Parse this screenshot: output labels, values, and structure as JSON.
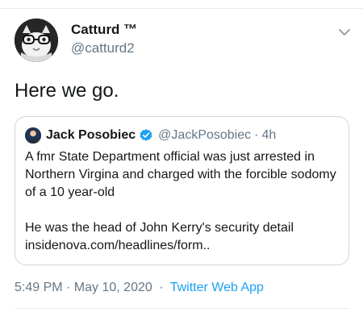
{
  "tweet": {
    "author": {
      "display_name": "Catturd ™",
      "handle": "@catturd2",
      "avatar_icon": "cat-with-glasses-avatar"
    },
    "text": "Here we go.",
    "menu_icon": "chevron-down-icon",
    "quoted_tweet": {
      "author": {
        "display_name": "Jack Posobiec",
        "handle": "@JackPosobiec",
        "verified": true,
        "avatar_icon": "person-avatar"
      },
      "separator": "·",
      "time": "4h",
      "paragraphs": [
        "A fmr State Department official was just arrested in Northern Virgina and charged with the forcible sodomy of a 10 year-old",
        "He was the head of John Kerry's security detail insidenova.com/headlines/form.."
      ]
    },
    "footer": {
      "timestamp": "5:49 PM · May 10, 2020",
      "separator": "·",
      "source": "Twitter Web App"
    }
  },
  "colors": {
    "text": "#14171a",
    "secondary_text": "#657786",
    "link": "#1da1f2",
    "divider": "#e6ecf0",
    "quote_border": "#ccd6dd",
    "verified": "#1da1f2"
  }
}
